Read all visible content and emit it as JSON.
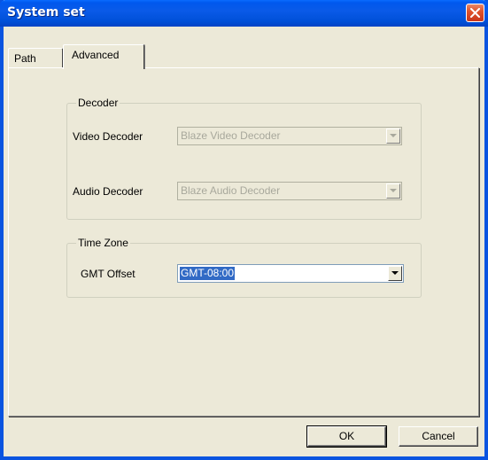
{
  "window": {
    "title": "System set"
  },
  "tabs": [
    {
      "label": "Path",
      "active": false
    },
    {
      "label": "Advanced",
      "active": true
    }
  ],
  "decoder_group": {
    "legend": "Decoder",
    "video_label": "Video Decoder",
    "video_value": "Blaze Video Decoder",
    "audio_label": "Audio Decoder",
    "audio_value": "Blaze Audio Decoder"
  },
  "timezone_group": {
    "legend": "Time Zone",
    "gmt_label": "GMT Offset",
    "gmt_value": "GMT-08:00"
  },
  "buttons": {
    "ok_label": "OK",
    "cancel_label": "Cancel"
  },
  "icons": {
    "close": "close-icon",
    "dropdown": "chevron-down-icon"
  },
  "colors": {
    "titlebar": "#0a5ae8",
    "selection": "#316ac5",
    "close_button": "#e0542c"
  }
}
